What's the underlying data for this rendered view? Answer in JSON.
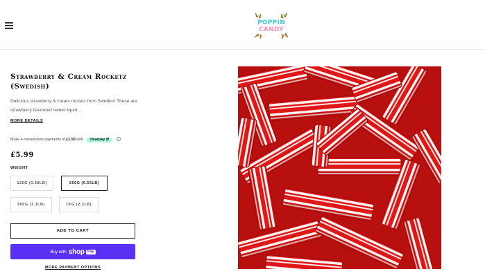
{
  "header": {
    "logo_line1": "POPPIN",
    "logo_line2": "CANDY"
  },
  "product": {
    "title": "Strawberry & Cream Rocketz (Swedish)",
    "description": "Delicious strawberry & cream rocketz from Sweden! These are strawberry flavoured sweet liquor...",
    "more_details": "MORE DETAILS",
    "clearpay_prefix": "Make 4 interest-free payments of ",
    "clearpay_amount": "£1.50",
    "clearpay_with": " with",
    "clearpay_brand": "clearpay",
    "price": "£5.99",
    "weight_label": "WEIGHT",
    "options": [
      "125G (0.28LB)",
      "250G (0.55LB)",
      "500G (1.1LB)",
      "1KG (2.2LB)"
    ],
    "selected_option": "250G (0.55LB)",
    "add_to_cart": "ADD TO CART",
    "shop_pay_prefix": "Buy with",
    "shop_pay_shop": "shop",
    "shop_pay_pay": "Pay",
    "more_payment": "MORE PAYMENT OPTIONS"
  },
  "colors": {
    "accent": "#5a31f4",
    "clearpay": "#b2fce4",
    "candy_red": "#e21b1b",
    "logo_blue": "#45c6d8",
    "logo_pink": "#f48fc8"
  }
}
